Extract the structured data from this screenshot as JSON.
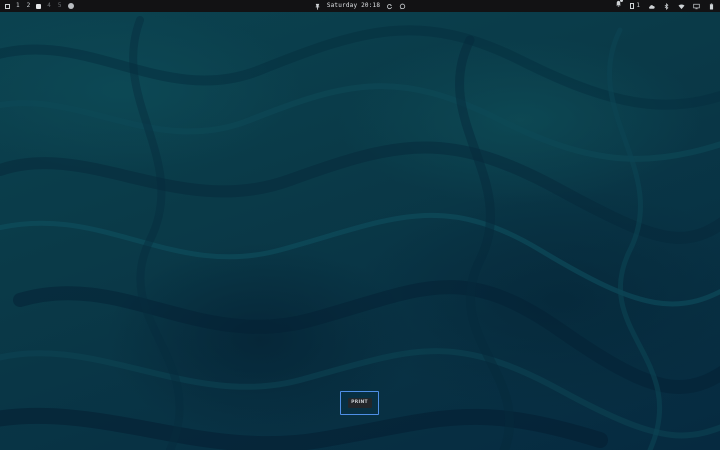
{
  "desktop": {
    "wallpaper": "dark teal marbled swirl",
    "colors": {
      "base": "#0a3a47",
      "panel": "#121214",
      "accent": "#4f8fe6"
    }
  },
  "topbar": {
    "workspaces": [
      {
        "label": "1",
        "state": "normal"
      },
      {
        "label": "2",
        "state": "normal"
      },
      {
        "label": "",
        "state": "active"
      },
      {
        "label": "4",
        "state": "dim"
      },
      {
        "label": "5",
        "state": "dim"
      }
    ],
    "clock": "Saturday 20:18",
    "icons_left": [
      "window-overview-icon",
      "circle-indicator-icon"
    ],
    "icons_center": [
      "pin-icon",
      "refresh-icon",
      "chat-icon"
    ],
    "icons_right": [
      "notification-bell-icon",
      "cloud-icon",
      "bluetooth-icon",
      "wifi-icon",
      "display-icon",
      "battery-icon"
    ],
    "clipboard_count": "1"
  },
  "print_dialog": {
    "button_label": "PRINT"
  }
}
